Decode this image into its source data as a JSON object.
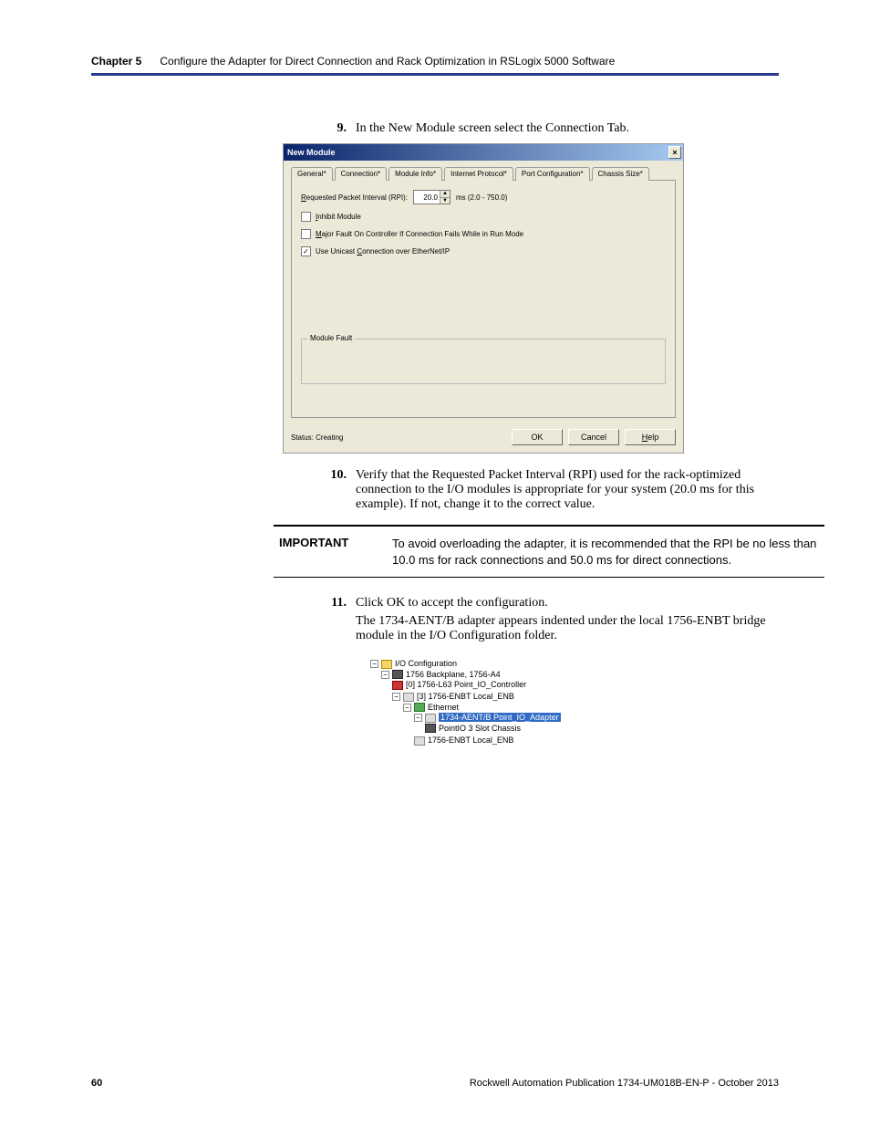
{
  "header": {
    "chapter_label": "Chapter 5",
    "chapter_title": "Configure the Adapter for Direct Connection and Rack Optimization in RSLogix 5000 Software"
  },
  "steps": {
    "s9": {
      "num": "9.",
      "text": "In the New Module screen select the Connection Tab."
    },
    "s10": {
      "num": "10.",
      "text": "Verify that the Requested Packet Interval (RPI) used for the rack-optimized connection to the I/O modules is appropriate for your system (20.0 ms for this example). If not, change it to the correct value."
    },
    "s11": {
      "num": "11.",
      "text1": "Click OK to accept the configuration.",
      "text2": "The 1734-AENT/B adapter appears indented under the local 1756-ENBT bridge module in the I/O Configuration folder."
    }
  },
  "important": {
    "label": "IMPORTANT",
    "text": "To avoid overloading the adapter, it is recommended that the RPI be no less than 10.0 ms for rack connections and 50.0 ms for direct connections."
  },
  "dialog": {
    "title": "New Module",
    "tabs": {
      "general": "General*",
      "connection": "Connection*",
      "module_info": "Module Info*",
      "internet_protocol": "Internet Protocol*",
      "port_config": "Port Configuration*",
      "chassis_size": "Chassis Size*"
    },
    "rpi_label": "Requested Packet Interval (RPI):",
    "rpi_value": "20.0",
    "rpi_range": "ms (2.0 - 750.0)",
    "inhibit": "Inhibit Module",
    "major_fault": "Major Fault On Controller If Connection Fails While in Run Mode",
    "unicast": "Use Unicast Connection over EtherNet/IP",
    "module_fault_label": "Module Fault",
    "status_label": "Status: Creating",
    "ok": "OK",
    "cancel": "Cancel",
    "help": "Help"
  },
  "tree": {
    "root": "I/O Configuration",
    "backplane": "1756 Backplane, 1756-A4",
    "controller": "[0] 1756-L63 Point_IO_Controller",
    "enbt": "[3] 1756-ENBT Local_ENB",
    "ethernet": "Ethernet",
    "aent": "1734-AENT/B Point_IO_Adapter",
    "chassis": "PointIO 3 Slot Chassis",
    "enbt2": "1756-ENBT Local_ENB"
  },
  "footer": {
    "page": "60",
    "pub": "Rockwell Automation Publication 1734-UM018B-EN-P - October 2013"
  }
}
